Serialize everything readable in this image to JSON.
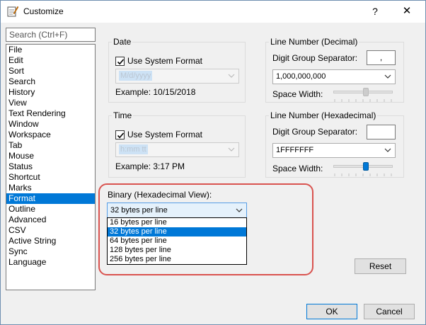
{
  "window": {
    "title": "Customize",
    "help_glyph": "?",
    "close_glyph": "✕"
  },
  "search": {
    "placeholder": "Search (Ctrl+F)"
  },
  "categories": [
    {
      "label": "File"
    },
    {
      "label": "Edit"
    },
    {
      "label": "Sort"
    },
    {
      "label": "Search"
    },
    {
      "label": "History"
    },
    {
      "label": "View"
    },
    {
      "label": "Text Rendering"
    },
    {
      "label": "Window"
    },
    {
      "label": "Workspace"
    },
    {
      "label": "Tab"
    },
    {
      "label": "Mouse"
    },
    {
      "label": "Status"
    },
    {
      "label": "Shortcut"
    },
    {
      "label": "Marks"
    },
    {
      "label": "Format"
    },
    {
      "label": "Outline"
    },
    {
      "label": "Advanced"
    },
    {
      "label": "CSV"
    },
    {
      "label": "Active String"
    },
    {
      "label": "Sync"
    },
    {
      "label": "Language"
    }
  ],
  "selected_category": "Format",
  "date": {
    "title": "Date",
    "use_system_label": "Use System Format",
    "use_system_checked": true,
    "format_value": "M/d/yyyy",
    "example": "Example: 10/15/2018"
  },
  "time": {
    "title": "Time",
    "use_system_label": "Use System Format",
    "use_system_checked": true,
    "format_value": "h:mm tt",
    "example": "Example: 3:17 PM"
  },
  "line_decimal": {
    "title": "Line Number (Decimal)",
    "separator_label": "Digit Group Separator:",
    "separator_value": ",",
    "format_value": "1,000,000,000",
    "space_label": "Space Width:",
    "space_level": 0.55
  },
  "line_hex": {
    "title": "Line Number (Hexadecimal)",
    "separator_label": "Digit Group Separator:",
    "separator_value": "",
    "format_value": "1FFFFFFF",
    "space_label": "Space Width:",
    "space_level": 0.55
  },
  "binary": {
    "title": "Binary (Hexadecimal View):",
    "selected": "32 bytes per line",
    "options": [
      "16 bytes per line",
      "32 bytes per line",
      "64 bytes per line",
      "128 bytes per line",
      "256 bytes per line"
    ]
  },
  "buttons": {
    "reset": "Reset",
    "ok": "OK",
    "cancel": "Cancel"
  },
  "colors": {
    "selection": "#0078d7",
    "highlight_ring": "#d9534f",
    "slider_thumb": "#0078d7"
  }
}
